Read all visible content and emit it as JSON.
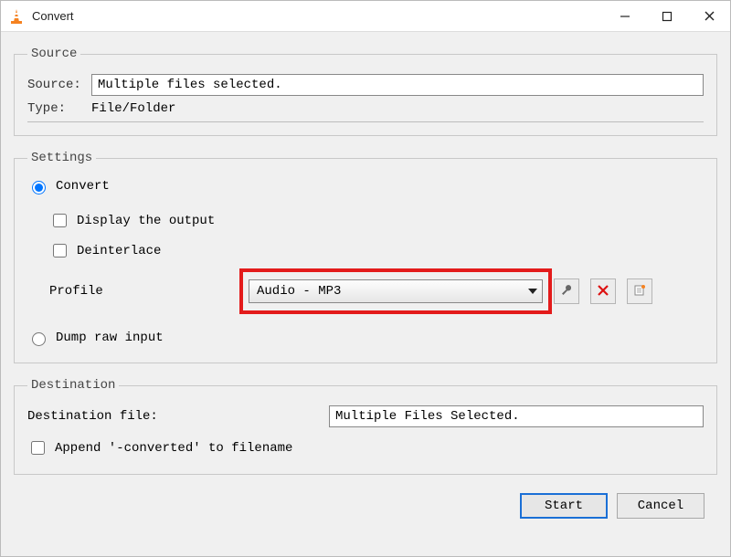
{
  "window": {
    "title": "Convert"
  },
  "source": {
    "legend": "Source",
    "source_label": "Source:",
    "source_value": "Multiple files selected.",
    "type_label": "Type:",
    "type_value": "File/Folder"
  },
  "settings": {
    "legend": "Settings",
    "convert_label": "Convert",
    "display_output_label": "Display the output",
    "deinterlace_label": "Deinterlace",
    "profile_label": "Profile",
    "profile_value": "Audio - MP3",
    "dump_label": "Dump raw input"
  },
  "destination": {
    "legend": "Destination",
    "file_label": "Destination file:",
    "file_value": "Multiple Files Selected.",
    "append_label": "Append '-converted' to filename"
  },
  "buttons": {
    "start": "Start",
    "cancel": "Cancel"
  }
}
